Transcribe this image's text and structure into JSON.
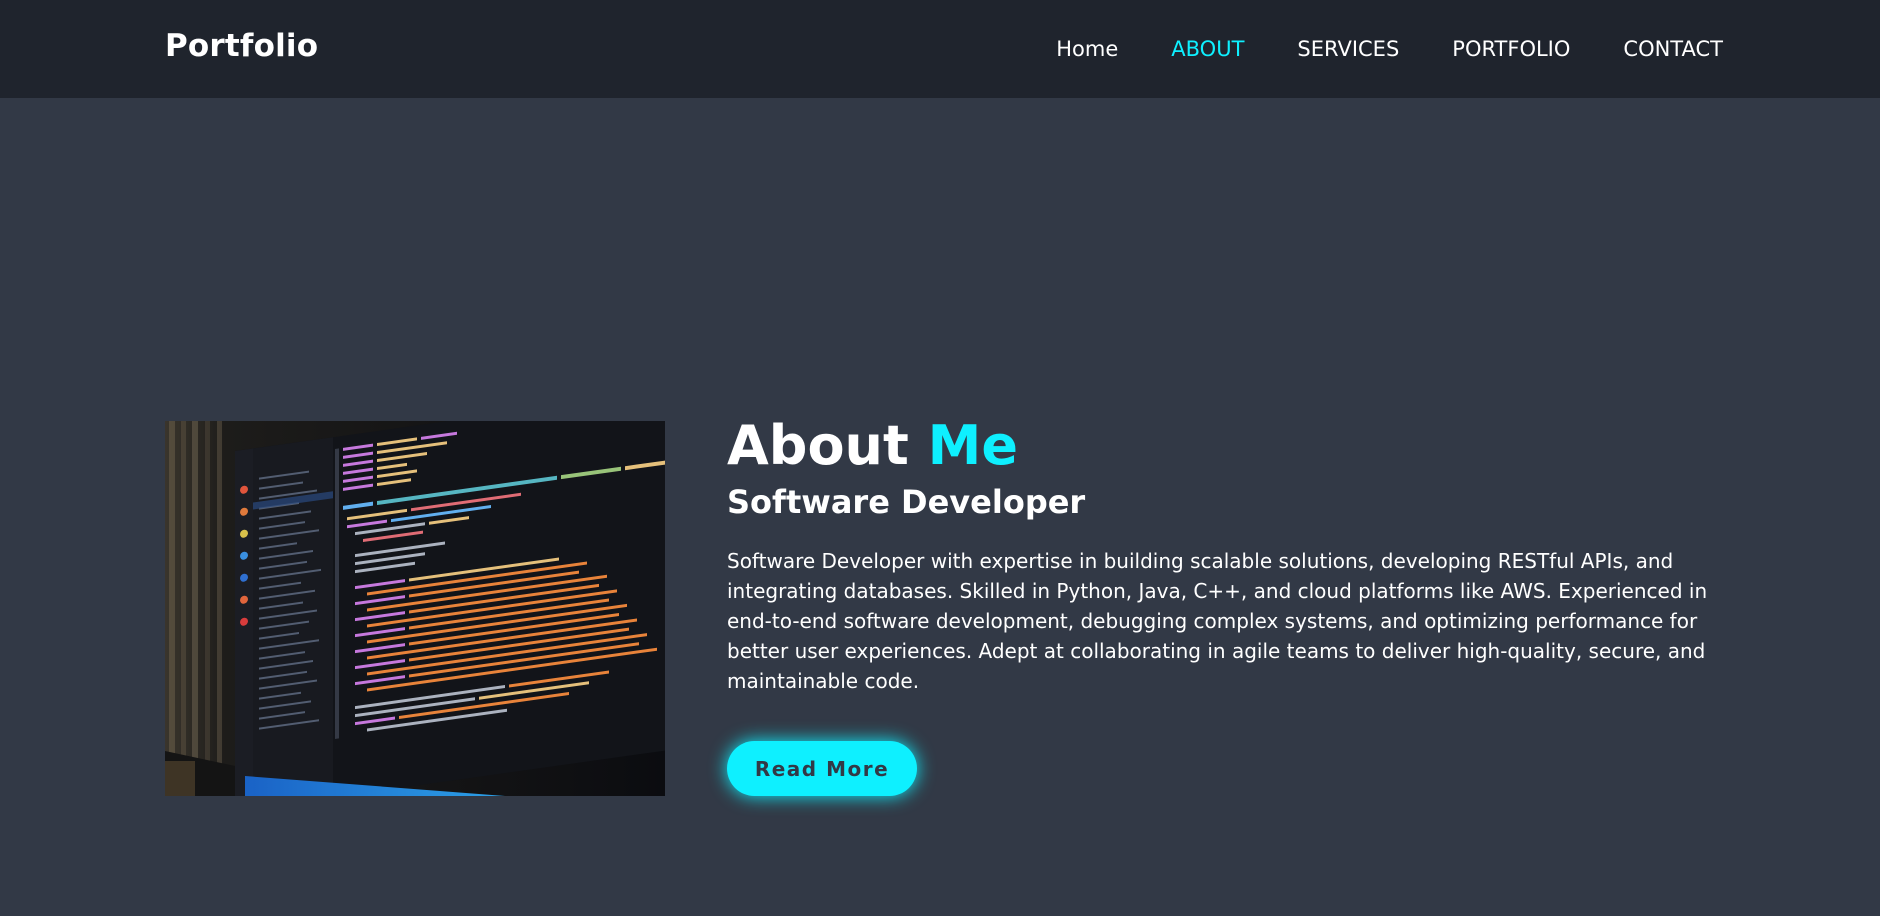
{
  "header": {
    "logo": "Portfolio",
    "nav": [
      {
        "label": "Home"
      },
      {
        "label": "ABOUT",
        "active": true
      },
      {
        "label": "SERVICES"
      },
      {
        "label": "PORTFOLIO"
      },
      {
        "label": "CONTACT"
      }
    ]
  },
  "about": {
    "image_alt": "code-editor-photo",
    "heading_main": "About",
    "heading_accent": "Me",
    "subtitle": "Software Developer",
    "bio": "Software Developer with expertise in building scalable solutions, developing RESTful APIs, and integrating databases. Skilled in Python, Java, C++, and cloud platforms like AWS. Experienced in end-to-end software development, debugging complex systems, and optimizing performance for better user experiences. Adept at collaborating in agile teams to deliver high-quality, secure, and maintainable code.",
    "button_label": "Read More"
  },
  "colors": {
    "background": "#323946",
    "header_background": "#1f242d",
    "accent": "#0ef0ff",
    "text": "#ffffff"
  }
}
